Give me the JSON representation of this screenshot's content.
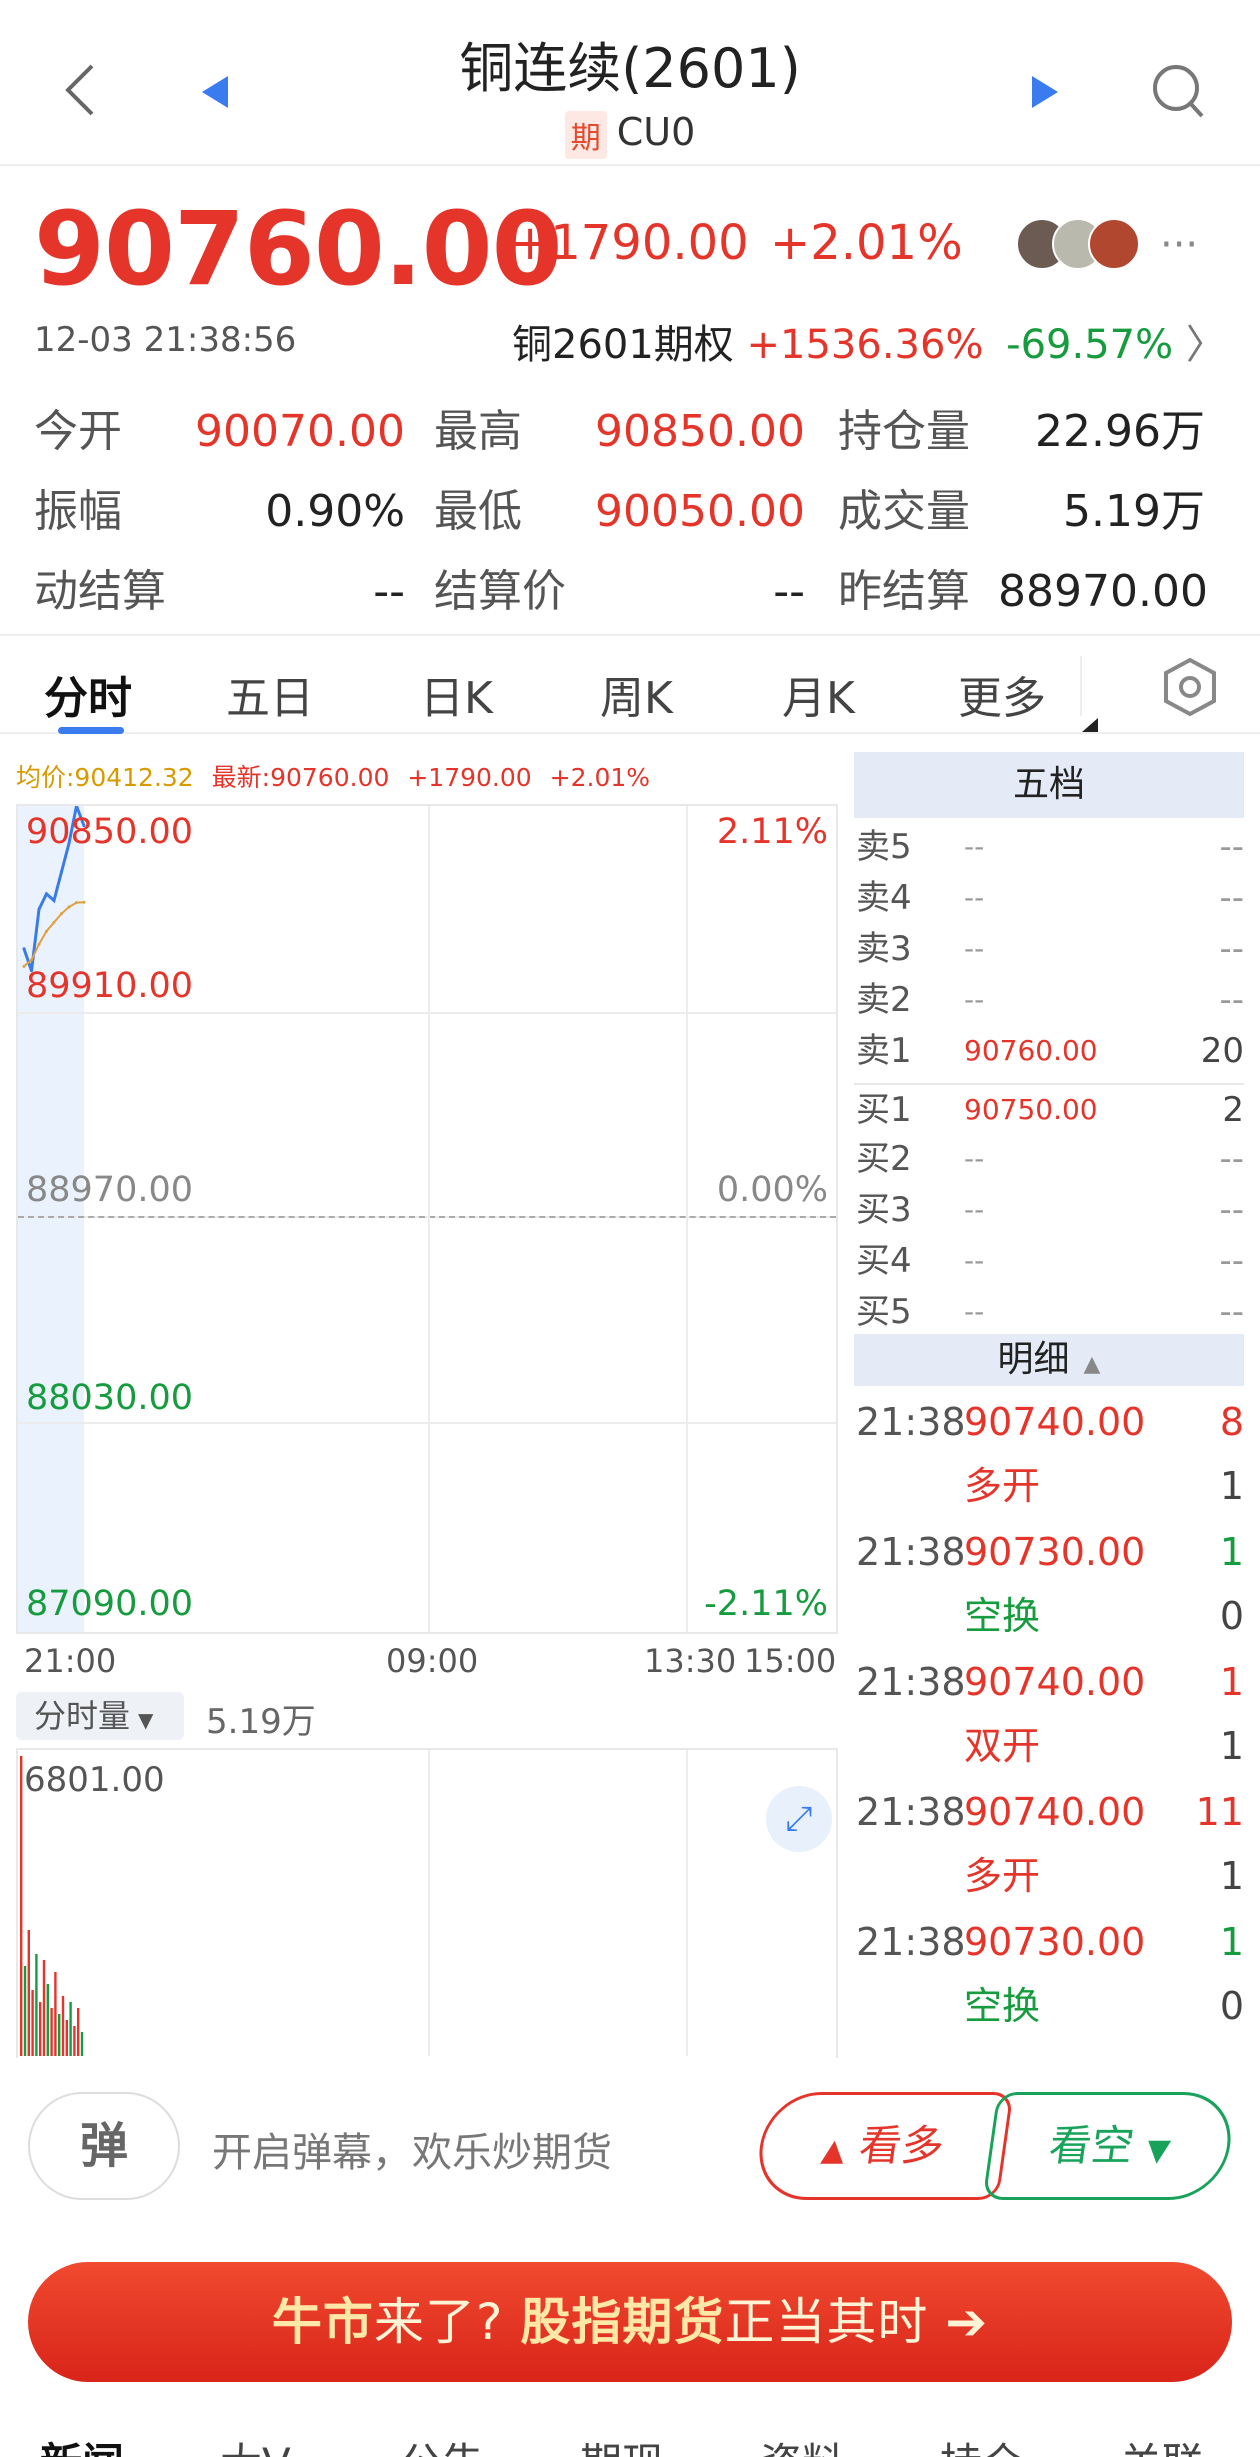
{
  "header": {
    "title": "铜连续(2601)",
    "badge": "期",
    "code": "CU0"
  },
  "quote": {
    "price": "90760.00",
    "change": "+1790.00",
    "change_pct": "+2.01%",
    "time": "12-03 21:38:56",
    "option_label": "铜2601期权",
    "option_up": "+1536.36%",
    "option_down": "-69.57%",
    "stats": [
      {
        "label": "今开",
        "value": "90070.00",
        "color": "red"
      },
      {
        "label": "最高",
        "value": "90850.00",
        "color": "red"
      },
      {
        "label": "持仓量",
        "value": "22.96万",
        "color": "black"
      },
      {
        "label": "振幅",
        "value": "0.90%",
        "color": "black"
      },
      {
        "label": "最低",
        "value": "90050.00",
        "color": "red"
      },
      {
        "label": "成交量",
        "value": "5.19万",
        "color": "black"
      },
      {
        "label": "动结算",
        "value": "--",
        "color": "black"
      },
      {
        "label": "结算价",
        "value": "--",
        "color": "black"
      },
      {
        "label": "昨结算",
        "value": "88970.00",
        "color": "black"
      }
    ]
  },
  "tabs": [
    "分时",
    "五日",
    "日K",
    "周K",
    "月K",
    "更多"
  ],
  "chart": {
    "avg_label": "均价:90412.32",
    "latest_label": "最新:90760.00",
    "chg": "+1790.00",
    "pct": "+2.01%",
    "y_left": [
      "90850.00",
      "89910.00",
      "88970.00",
      "88030.00",
      "87090.00"
    ],
    "y_right": [
      "2.11%",
      "0.00%",
      "-2.11%"
    ],
    "x_labels": [
      "21:00",
      "09:00",
      "13:30",
      "15:00"
    ],
    "vol_label": "分时量",
    "vol_total": "5.19万",
    "vol_max": "6801.00"
  },
  "chart_data": {
    "type": "line",
    "x": [
      "21:00",
      "21:05",
      "21:10",
      "21:15",
      "21:20",
      "21:25",
      "21:30",
      "21:35",
      "21:38"
    ],
    "series": [
      {
        "values": [
          90200,
          90100,
          90380,
          90450,
          90420,
          90550,
          90680,
          90850,
          90760
        ]
      },
      {
        "values": [
          90120,
          90150,
          90220,
          90280,
          90320,
          90360,
          90390,
          90410,
          90412
        ]
      }
    ],
    "ylim": [
      87090,
      90850
    ],
    "y_ticks": [
      "90850.00",
      "89910.00",
      "88970.00",
      "88030.00",
      "87090.00"
    ],
    "colors": {
      "price": "#3a7be8",
      "avg": "#e0a040"
    }
  },
  "orderbook": {
    "header": "五档",
    "rows": [
      {
        "label": "卖5",
        "price": "--",
        "vol": "--"
      },
      {
        "label": "卖4",
        "price": "--",
        "vol": "--"
      },
      {
        "label": "卖3",
        "price": "--",
        "vol": "--"
      },
      {
        "label": "卖2",
        "price": "--",
        "vol": "--"
      },
      {
        "label": "卖1",
        "price": "90760.00",
        "vol": "20"
      },
      {
        "label": "买1",
        "price": "90750.00",
        "vol": "2"
      },
      {
        "label": "买2",
        "price": "--",
        "vol": "--"
      },
      {
        "label": "买3",
        "price": "--",
        "vol": "--"
      },
      {
        "label": "买4",
        "price": "--",
        "vol": "--"
      },
      {
        "label": "买5",
        "price": "--",
        "vol": "--"
      }
    ],
    "detail_header": "明细",
    "trades": [
      {
        "time": "21:38",
        "price": "90740.00",
        "vol": "8",
        "vc": "red",
        "type": "多开",
        "tc": "red",
        "tv": "1"
      },
      {
        "time": "21:38",
        "price": "90730.00",
        "vol": "1",
        "vc": "green",
        "type": "空换",
        "tc": "green",
        "tv": "0"
      },
      {
        "time": "21:38",
        "price": "90740.00",
        "vol": "1",
        "vc": "red",
        "type": "双开",
        "tc": "red",
        "tv": "1"
      },
      {
        "time": "21:38",
        "price": "90740.00",
        "vol": "11",
        "vc": "red",
        "type": "多开",
        "tc": "red",
        "tv": "1"
      },
      {
        "time": "21:38",
        "price": "90730.00",
        "vol": "1",
        "vc": "green",
        "type": "空换",
        "tc": "green",
        "tv": "0"
      }
    ]
  },
  "actions": {
    "danmu_icon": "弹",
    "danmu_text": "开启弹幕，欢乐炒期货",
    "bull": "看多",
    "bear": "看空"
  },
  "banner": {
    "p1": "牛市",
    "p2": "来了?",
    "p3": "股指期货",
    "p4": "正当其时 ➔"
  },
  "bottom_tabs": [
    "新闻",
    "大V",
    "公告",
    "期现",
    "资料",
    "持仓",
    "关联"
  ]
}
